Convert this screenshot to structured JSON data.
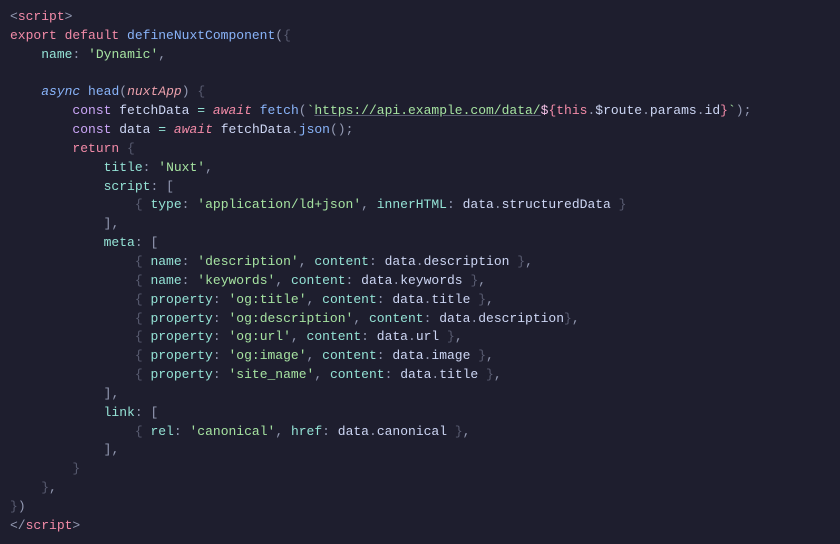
{
  "code": {
    "line1": {
      "open": "<",
      "tag": "script",
      "close": ">"
    },
    "line2": {
      "export": "export",
      "default": "default",
      "fn": "defineNuxtComponent",
      "paren_o": "(",
      "brace_o": "{"
    },
    "line3": {
      "key": "name",
      "colon": ":",
      "str": "'Dynamic'",
      "comma": ","
    },
    "line4": "",
    "line5": {
      "async": "async",
      "head": "head",
      "paren_o": "(",
      "param": "nuxtApp",
      "paren_c": ")",
      "brace_o": "{"
    },
    "line6": {
      "const": "const",
      "ident": "fetchData",
      "eq": "=",
      "await": "await",
      "fn": "fetch",
      "paren_o": "(",
      "tick": "`",
      "url": "https://api.example.com/data/",
      "dollar": "$",
      "tbrace_o": "{",
      "this": "this",
      "dot1": ".",
      "p1": "$route",
      "dot2": ".",
      "p2": "params",
      "dot3": ".",
      "p3": "id",
      "tbrace_c": "}",
      "tick2": "`",
      "paren_c": ")",
      "semi": ";"
    },
    "line7": {
      "const": "const",
      "ident": "data",
      "eq": "=",
      "await": "await",
      "src": "fetchData",
      "dot": ".",
      "method": "json",
      "paren_o": "(",
      "paren_c": ")",
      "semi": ";"
    },
    "line8": {
      "return": "return",
      "brace_o": "{"
    },
    "line9": {
      "key": "title",
      "colon": ":",
      "str": "'Nuxt'",
      "comma": ","
    },
    "line10": {
      "key": "script",
      "colon": ":",
      "bracket_o": "["
    },
    "line11": {
      "brace_o": "{",
      "k1": "type",
      "c1": ":",
      "s1": "'application/ld+json'",
      "comma1": ",",
      "k2": "innerHTML",
      "c2": ":",
      "d": "data",
      "dot": ".",
      "p": "structuredData",
      "brace_c": "}"
    },
    "line12": {
      "bracket_c": "]",
      "comma": ","
    },
    "line13": {
      "key": "meta",
      "colon": ":",
      "bracket_o": "["
    },
    "line14": {
      "brace_o": "{",
      "k": "name",
      "c": ":",
      "s": "'description'",
      "comma1": ",",
      "k2": "content",
      "c2": ":",
      "d": "data",
      "dot": ".",
      "p": "description",
      "brace_c": "}",
      "comma2": ","
    },
    "line15": {
      "brace_o": "{",
      "k": "name",
      "c": ":",
      "s": "'keywords'",
      "comma1": ",",
      "k2": "content",
      "c2": ":",
      "d": "data",
      "dot": ".",
      "p": "keywords",
      "brace_c": "}",
      "comma2": ","
    },
    "line16": {
      "brace_o": "{",
      "k": "property",
      "c": ":",
      "s": "'og:title'",
      "comma1": ",",
      "k2": "content",
      "c2": ":",
      "d": "data",
      "dot": ".",
      "p": "title",
      "brace_c": "}",
      "comma2": ","
    },
    "line17": {
      "brace_o": "{",
      "k": "property",
      "c": ":",
      "s": "'og:description'",
      "comma1": ",",
      "k2": "content",
      "c2": ":",
      "d": "data",
      "dot": ".",
      "p": "description",
      "brace_c": "}",
      "comma2": ","
    },
    "line18": {
      "brace_o": "{",
      "k": "property",
      "c": ":",
      "s": "'og:url'",
      "comma1": ",",
      "k2": "content",
      "c2": ":",
      "d": "data",
      "dot": ".",
      "p": "url",
      "brace_c": "}",
      "comma2": ","
    },
    "line19": {
      "brace_o": "{",
      "k": "property",
      "c": ":",
      "s": "'og:image'",
      "comma1": ",",
      "k2": "content",
      "c2": ":",
      "d": "data",
      "dot": ".",
      "p": "image",
      "brace_c": "}",
      "comma2": ","
    },
    "line20": {
      "brace_o": "{",
      "k": "property",
      "c": ":",
      "s": "'site_name'",
      "comma1": ",",
      "k2": "content",
      "c2": ":",
      "d": "data",
      "dot": ".",
      "p": "title",
      "brace_c": "}",
      "comma2": ","
    },
    "line21": {
      "bracket_c": "]",
      "comma": ","
    },
    "line22": {
      "key": "link",
      "colon": ":",
      "bracket_o": "["
    },
    "line23": {
      "brace_o": "{",
      "k": "rel",
      "c": ":",
      "s": "'canonical'",
      "comma1": ",",
      "k2": "href",
      "c2": ":",
      "d": "data",
      "dot": ".",
      "p": "canonical",
      "brace_c": "}",
      "comma2": ","
    },
    "line24": {
      "bracket_c": "]",
      "comma": ","
    },
    "line25": {
      "brace_c": "}"
    },
    "line26": {
      "brace_c": "}",
      "comma": ","
    },
    "line27": {
      "brace_c": "}",
      "paren_c": ")"
    },
    "line28": {
      "open": "</",
      "tag": "script",
      "close": ">"
    }
  }
}
